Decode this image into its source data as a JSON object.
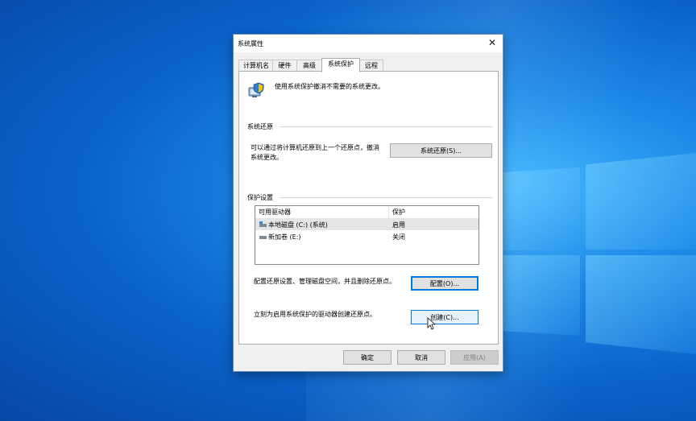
{
  "dialog": {
    "title": "系统属性",
    "close_icon": "close-icon"
  },
  "tabs": [
    {
      "label": "计算机名",
      "active": false
    },
    {
      "label": "硬件",
      "active": false
    },
    {
      "label": "高级",
      "active": false
    },
    {
      "label": "系统保护",
      "active": true
    },
    {
      "label": "远程",
      "active": false
    }
  ],
  "intro": {
    "icon": "system-protection-shield-icon",
    "text": "使用系统保护撤消不需要的系统更改。"
  },
  "restore": {
    "group_label": "系统还原",
    "desc_line1": "可以通过将计算机还原到上一个还原点，撤消",
    "desc_line2": "系统更改。",
    "button_label": "系统还原(S)..."
  },
  "protection": {
    "group_label": "保护设置",
    "columns": [
      "可用驱动器",
      "保护"
    ],
    "drives": [
      {
        "name": "本地磁盘 (C:) (系统)",
        "status": "启用",
        "icon": "system-drive-icon",
        "selected": true
      },
      {
        "name": "新加卷 (E:)",
        "status": "关闭",
        "icon": "drive-icon",
        "selected": false
      }
    ],
    "configure_desc": "配置还原设置、管理磁盘空间，并且删除还原点。",
    "configure_label": "配置(O)...",
    "create_desc": "立刻为启用系统保护的驱动器创建还原点。",
    "create_label": "创建(C)..."
  },
  "footer": {
    "ok_label": "确定",
    "cancel_label": "取消",
    "apply_label": "应用(A)"
  }
}
